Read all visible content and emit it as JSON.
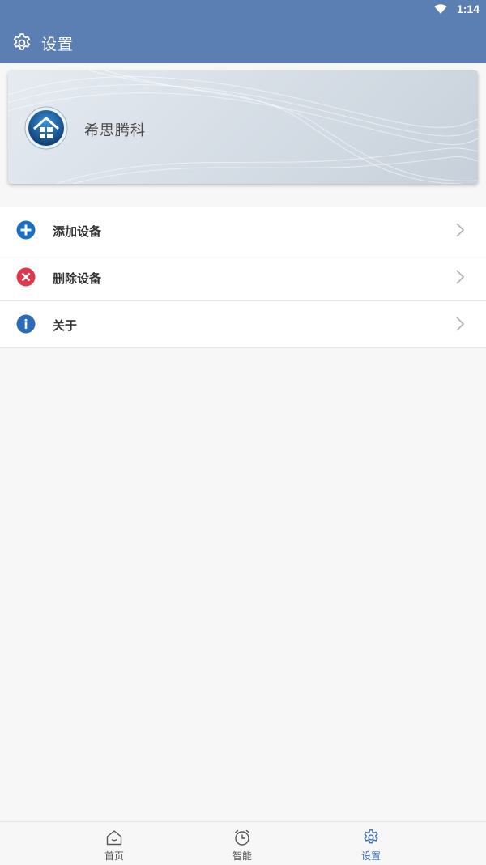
{
  "status_bar": {
    "time": "1:14",
    "wifi_icon": "wifi-icon"
  },
  "app_bar": {
    "title": "设置",
    "icon": "gear-icon",
    "color": "#5b7fb2"
  },
  "profile": {
    "name": "希思腾科",
    "logo_icon": "home-logo-icon"
  },
  "menu": [
    {
      "label": "添加设备",
      "icon": "add-circle-icon",
      "icon_color": "#1a6ec0"
    },
    {
      "label": "删除设备",
      "icon": "remove-circle-icon",
      "icon_color": "#e0384a"
    },
    {
      "label": "关于",
      "icon": "info-circle-icon",
      "icon_color": "#2c6cb8"
    }
  ],
  "tabs": [
    {
      "label": "首页",
      "icon": "home-icon",
      "active": false
    },
    {
      "label": "智能",
      "icon": "alarm-clock-icon",
      "active": false
    },
    {
      "label": "设置",
      "icon": "gear-icon",
      "active": true
    }
  ],
  "colors": {
    "accent": "#3d6fb3",
    "chevron": "#b5b5b5"
  }
}
